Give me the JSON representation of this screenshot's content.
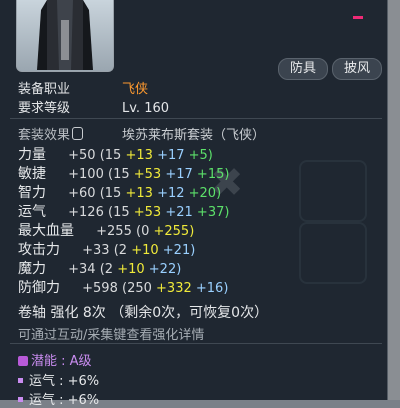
{
  "tags": {
    "armor": "防具",
    "cape": "披风"
  },
  "job": {
    "label": "装备职业",
    "value": "飞侠"
  },
  "level": {
    "label": "要求等级",
    "value": "Lv. 160"
  },
  "set": {
    "label": "套装效果",
    "value": "埃苏莱布斯套装（飞侠）"
  },
  "stats": [
    {
      "name": "力量",
      "total": "+50",
      "open": "(15",
      "a": "+13",
      "b": "+17",
      "c": "+5)"
    },
    {
      "name": "敏捷",
      "total": "+100",
      "open": "(15",
      "a": "+53",
      "b": "+17",
      "c": "+15)"
    },
    {
      "name": "智力",
      "total": "+60",
      "open": "(15",
      "a": "+13",
      "b": "+12",
      "c": "+20)"
    },
    {
      "name": "运气",
      "total": "+126",
      "open": "(15",
      "a": "+53",
      "b": "+21",
      "c": "+37)"
    },
    {
      "name": "最大血量",
      "total": "+255",
      "open": "(0",
      "a": "+255)"
    },
    {
      "name": "攻击力",
      "total": "+33",
      "open": "(2",
      "a": "+10",
      "b": "+21)"
    },
    {
      "name": "魔力",
      "total": "+34",
      "open": "(2",
      "a": "+10",
      "b": "+22)"
    },
    {
      "name": "防御力",
      "total": "+598",
      "open": "(250",
      "a": "+332",
      "b": "+16)"
    }
  ],
  "scroll": {
    "label": "卷轴 强化 8次",
    "detail": "（剩余0次，可恢复0次）"
  },
  "hint": "可通过互动/采集键查看强化详情",
  "potential": {
    "label": "潜能 :",
    "grade": "A级"
  },
  "potential_lines": [
    {
      "text": "运气 : +6%"
    },
    {
      "text": "运气 : +6%"
    }
  ]
}
